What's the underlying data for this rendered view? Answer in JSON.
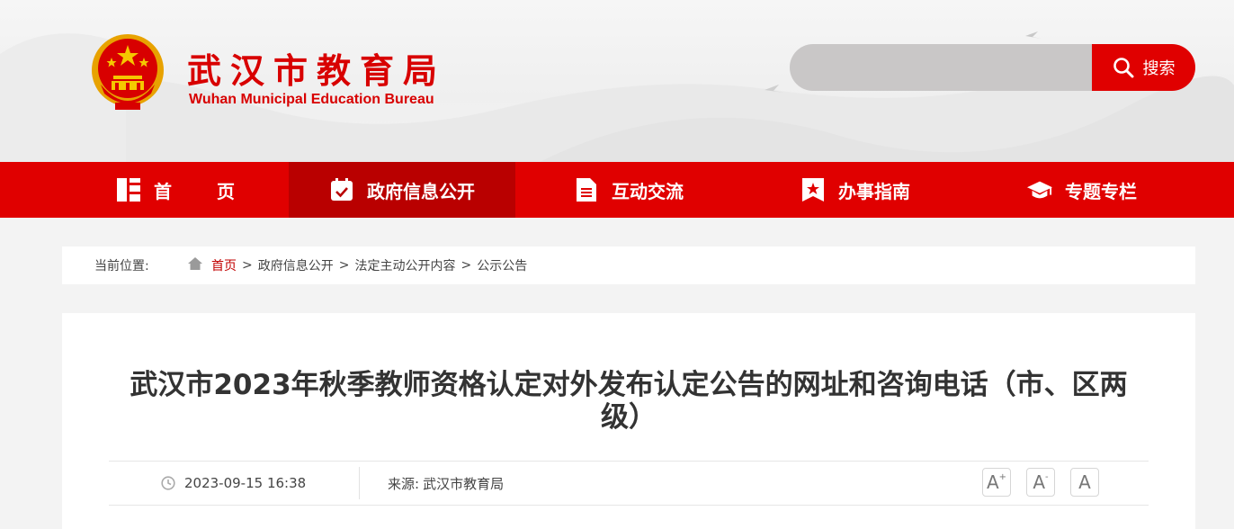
{
  "header": {
    "site_name": "武汉市教育局",
    "site_name_en": "Wuhan Municipal Education Bureau",
    "search": {
      "placeholder": "",
      "button_label": "搜索"
    }
  },
  "nav": {
    "items": [
      {
        "label": "首页",
        "icon": "grid-icon"
      },
      {
        "label": "政府信息公开",
        "icon": "calendar-check-icon",
        "active": true
      },
      {
        "label": "互动交流",
        "icon": "document-icon"
      },
      {
        "label": "办事指南",
        "icon": "bookmark-star-icon"
      },
      {
        "label": "专题专栏",
        "icon": "graduation-cap-icon"
      }
    ]
  },
  "breadcrumb": {
    "prefix": "当前位置:",
    "items": [
      "首页",
      "政府信息公开",
      "法定主动公开内容",
      "公示公告"
    ],
    "separator": ">"
  },
  "article": {
    "title": "武汉市2023年秋季教师资格认定对外发布认定公告的网址和咨询电话（市、区两级）",
    "date": "2023-09-15 16:38",
    "source_label": "来源:",
    "source_value": "武汉市教育局",
    "font_size_controls": [
      "A+",
      "A-",
      "A"
    ]
  },
  "colors": {
    "primary_red": "#e00000",
    "active_red": "#b90000"
  }
}
